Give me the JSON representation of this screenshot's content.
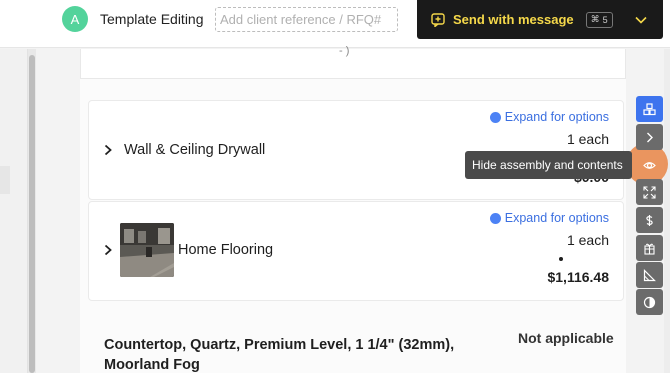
{
  "header": {
    "avatar_letter": "A",
    "title": "Template Editing",
    "reference_placeholder": "Add client reference / RFQ#",
    "send_label": "Send with message",
    "shortcut_key": "5",
    "shortcut_symbol": "⌘"
  },
  "items": [
    {
      "name": "Wall & Ceiling Drywall",
      "expand_label": "Expand for options",
      "quantity": "1 each",
      "price": "$0.00"
    },
    {
      "name": "Home Flooring",
      "expand_label": "Expand for options",
      "quantity": "1 each",
      "price": "$1,116.48"
    }
  ],
  "countertop": {
    "title": "Countertop, Quartz, Premium Level, 1 1/4\" (32mm), Moorland Fog",
    "status": "Not applicable"
  },
  "tooltip": "Hide assembly and contents",
  "toolbar": {
    "icons": [
      "assemblies-icon",
      "chevron-right-icon",
      "eye-icon",
      "expand-icon",
      "dollar-icon",
      "gift-icon",
      "measure-icon",
      "contrast-icon"
    ]
  },
  "colors": {
    "accent_blue": "#3d74ee",
    "send_yellow": "#f5d84a",
    "avatar_green": "#53d39b",
    "highlight_orange": "#e8803e"
  }
}
